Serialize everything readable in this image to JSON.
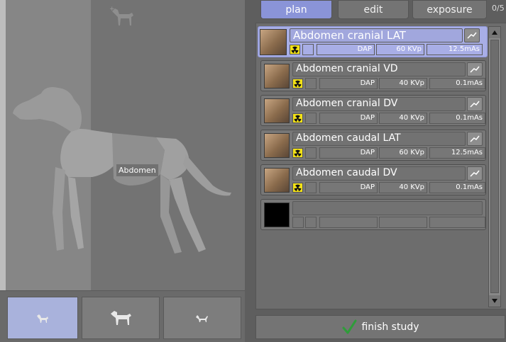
{
  "tabs": [
    {
      "label": "plan",
      "active": true
    },
    {
      "label": "edit",
      "active": false
    },
    {
      "label": "exposure",
      "active": false
    }
  ],
  "counter": "0/5",
  "anatomy": {
    "region_label": "Abdomen",
    "species": [
      {
        "icon": "dog-icon",
        "active": true
      },
      {
        "icon": "horse-icon",
        "active": false
      },
      {
        "icon": "cat-icon",
        "active": false
      }
    ]
  },
  "study_items": [
    {
      "title": "Abdomen cranial LAT",
      "dap": "DAP",
      "kvp": "60 KVp",
      "mas": "12.5mAs",
      "selected": true
    },
    {
      "title": "Abdomen cranial VD",
      "dap": "DAP",
      "kvp": "40 KVp",
      "mas": "0.1mAs",
      "selected": false
    },
    {
      "title": "Abdomen cranial DV",
      "dap": "DAP",
      "kvp": "40 KVp",
      "mas": "0.1mAs",
      "selected": false
    },
    {
      "title": "Abdomen caudal LAT",
      "dap": "DAP",
      "kvp": "60 KVp",
      "mas": "12.5mAs",
      "selected": false
    },
    {
      "title": "Abdomen caudal DV",
      "dap": "DAP",
      "kvp": "40 KVp",
      "mas": "0.1mAs",
      "selected": false
    }
  ],
  "finish_label": "finish study",
  "colors": {
    "accent": "#8a94d8",
    "selected_row": "#a8aee6",
    "radiation": "#f3e216",
    "checkmark": "#2f9c3a"
  }
}
